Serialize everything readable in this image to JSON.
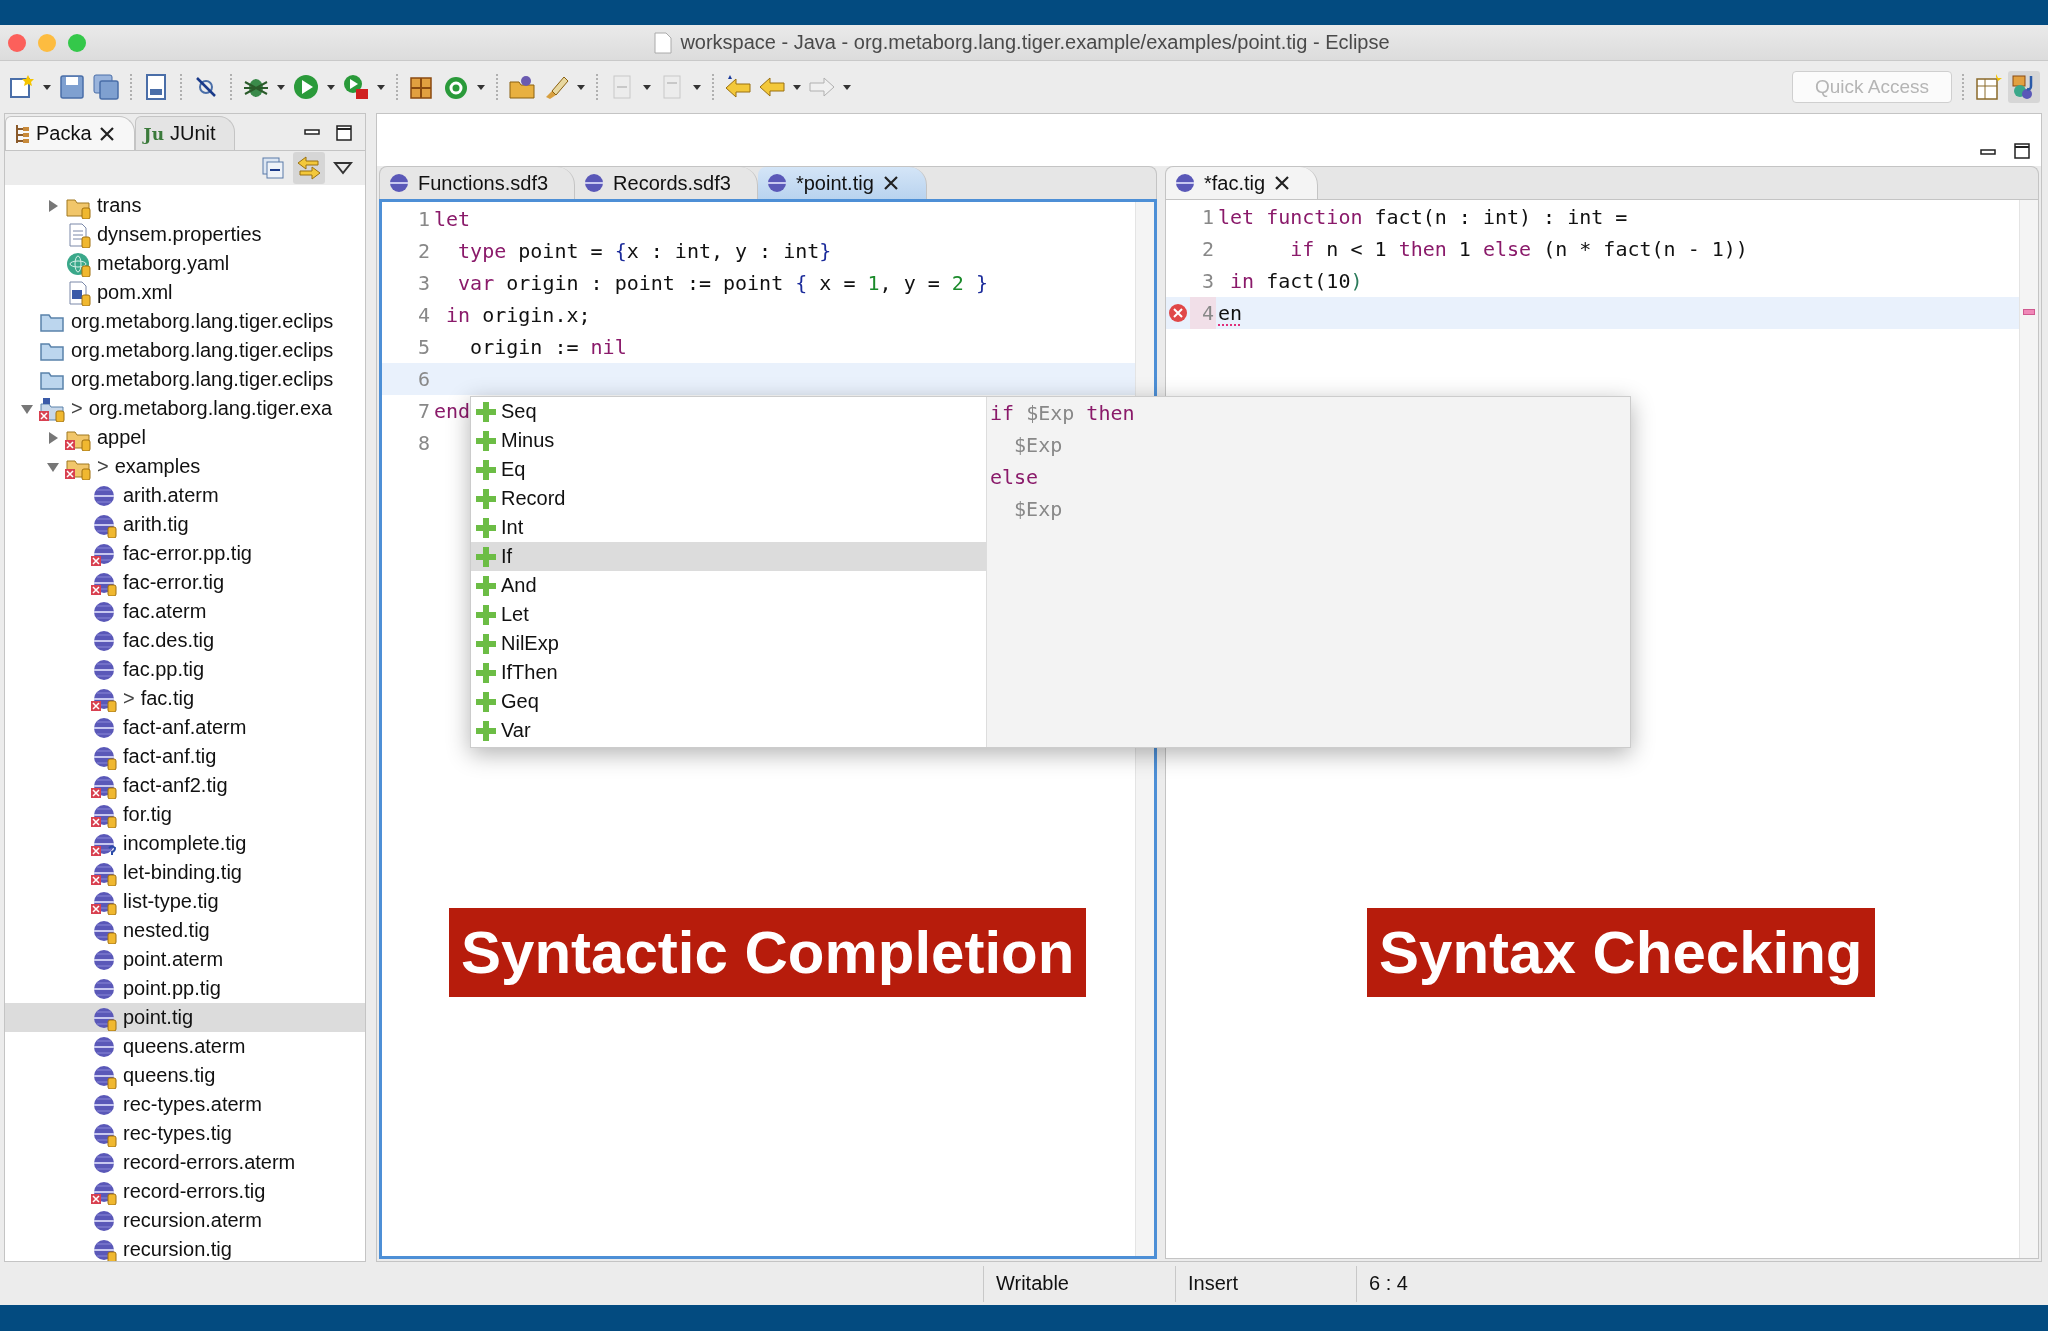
{
  "window": {
    "title": "workspace - Java - org.metaborg.lang.tiger.example/examples/point.tig - Eclipse"
  },
  "toolbar": {
    "quick_access": {
      "placeholder": "Quick Access"
    }
  },
  "left_panel": {
    "tabs": [
      {
        "label": "Packa",
        "selected": true,
        "closable": true,
        "kind": "package"
      },
      {
        "label": "JUnit",
        "selected": false,
        "closable": false,
        "kind": "junit",
        "icon_text": "Ju"
      }
    ],
    "tree": {
      "scrolled_children": [
        {
          "label": "trans",
          "kind": "package-folder",
          "expanded": false,
          "error": false,
          "locked": true,
          "unversioned": false,
          "selected": false
        },
        {
          "label": "dynsem.properties",
          "kind": "properties",
          "error": false,
          "locked": true,
          "unversioned": false,
          "selected": false
        },
        {
          "label": "metaborg.yaml",
          "kind": "yaml",
          "error": false,
          "locked": true,
          "unversioned": false,
          "selected": false
        },
        {
          "label": "pom.xml",
          "kind": "pom",
          "error": false,
          "locked": true,
          "unversioned": false,
          "selected": false
        }
      ],
      "items": [
        {
          "label": "org.metaborg.lang.tiger.eclips",
          "kind": "project",
          "error": false,
          "locked": false,
          "unversioned": false,
          "selected": false
        },
        {
          "label": "org.metaborg.lang.tiger.eclips",
          "kind": "project",
          "error": false,
          "locked": false,
          "unversioned": false,
          "selected": false
        },
        {
          "label": "org.metaborg.lang.tiger.eclips",
          "kind": "project",
          "error": false,
          "locked": false,
          "unversioned": false,
          "selected": false
        },
        {
          "label": "org.metaborg.lang.tiger.exa",
          "kind": "maven-project",
          "marker": ">",
          "expanded": true,
          "error": true,
          "locked": true,
          "unversioned": false,
          "selected": false,
          "children": [
            {
              "label": "appel",
              "kind": "source-folder",
              "expanded": false,
              "error": true,
              "locked": true,
              "unversioned": false,
              "selected": false
            },
            {
              "label": "examples",
              "kind": "source-folder",
              "marker": ">",
              "expanded": true,
              "error": true,
              "locked": true,
              "unversioned": false,
              "selected": false,
              "children": [
                {
                  "label": "arith.aterm",
                  "kind": "term",
                  "error": false,
                  "locked": false,
                  "unversioned": false,
                  "selected": false
                },
                {
                  "label": "arith.tig",
                  "kind": "term",
                  "error": false,
                  "locked": true,
                  "unversioned": false,
                  "selected": false
                },
                {
                  "label": "fac-error.pp.tig",
                  "kind": "term",
                  "error": true,
                  "locked": false,
                  "unversioned": false,
                  "selected": false
                },
                {
                  "label": "fac-error.tig",
                  "kind": "term",
                  "error": true,
                  "locked": true,
                  "unversioned": false,
                  "selected": false
                },
                {
                  "label": "fac.aterm",
                  "kind": "term",
                  "error": false,
                  "locked": false,
                  "unversioned": false,
                  "selected": false
                },
                {
                  "label": "fac.des.tig",
                  "kind": "term",
                  "error": false,
                  "locked": false,
                  "unversioned": false,
                  "selected": false
                },
                {
                  "label": "fac.pp.tig",
                  "kind": "term",
                  "error": false,
                  "locked": false,
                  "unversioned": false,
                  "selected": false
                },
                {
                  "label": "fac.tig",
                  "kind": "term",
                  "marker": ">",
                  "error": true,
                  "locked": true,
                  "unversioned": false,
                  "selected": false
                },
                {
                  "label": "fact-anf.aterm",
                  "kind": "term",
                  "error": false,
                  "locked": false,
                  "unversioned": false,
                  "selected": false
                },
                {
                  "label": "fact-anf.tig",
                  "kind": "term",
                  "error": false,
                  "locked": true,
                  "unversioned": false,
                  "selected": false
                },
                {
                  "label": "fact-anf2.tig",
                  "kind": "term",
                  "error": true,
                  "locked": true,
                  "unversioned": false,
                  "selected": false
                },
                {
                  "label": "for.tig",
                  "kind": "term",
                  "error": true,
                  "locked": true,
                  "unversioned": false,
                  "selected": false
                },
                {
                  "label": "incomplete.tig",
                  "kind": "term",
                  "error": true,
                  "locked": false,
                  "unversioned": true,
                  "selected": false
                },
                {
                  "label": "let-binding.tig",
                  "kind": "term",
                  "error": true,
                  "locked": true,
                  "unversioned": false,
                  "selected": false
                },
                {
                  "label": "list-type.tig",
                  "kind": "term",
                  "error": true,
                  "locked": true,
                  "unversioned": false,
                  "selected": false
                },
                {
                  "label": "nested.tig",
                  "kind": "term",
                  "error": false,
                  "locked": true,
                  "unversioned": false,
                  "selected": false
                },
                {
                  "label": "point.aterm",
                  "kind": "term",
                  "error": false,
                  "locked": false,
                  "unversioned": false,
                  "selected": false
                },
                {
                  "label": "point.pp.tig",
                  "kind": "term",
                  "error": false,
                  "locked": false,
                  "unversioned": false,
                  "selected": false
                },
                {
                  "label": "point.tig",
                  "kind": "term",
                  "error": false,
                  "locked": true,
                  "unversioned": false,
                  "selected": true
                },
                {
                  "label": "queens.aterm",
                  "kind": "term",
                  "error": false,
                  "locked": false,
                  "unversioned": false,
                  "selected": false
                },
                {
                  "label": "queens.tig",
                  "kind": "term",
                  "error": false,
                  "locked": true,
                  "unversioned": false,
                  "selected": false
                },
                {
                  "label": "rec-types.aterm",
                  "kind": "term",
                  "error": false,
                  "locked": false,
                  "unversioned": false,
                  "selected": false
                },
                {
                  "label": "rec-types.tig",
                  "kind": "term",
                  "error": false,
                  "locked": true,
                  "unversioned": false,
                  "selected": false
                },
                {
                  "label": "record-errors.aterm",
                  "kind": "term",
                  "error": false,
                  "locked": false,
                  "unversioned": false,
                  "selected": false
                },
                {
                  "label": "record-errors.tig",
                  "kind": "term",
                  "error": true,
                  "locked": true,
                  "unversioned": false,
                  "selected": false
                },
                {
                  "label": "recursion.aterm",
                  "kind": "term",
                  "error": false,
                  "locked": false,
                  "unversioned": false,
                  "selected": false
                },
                {
                  "label": "recursion.tig",
                  "kind": "term",
                  "error": false,
                  "locked": true,
                  "unversioned": false,
                  "selected": false
                }
              ]
            }
          ]
        }
      ]
    }
  },
  "editors": [
    {
      "active": true,
      "tabs": [
        {
          "label": "Functions.sdf3",
          "selected": false,
          "closable": false
        },
        {
          "label": "Records.sdf3",
          "selected": false,
          "closable": false
        },
        {
          "label": "*point.tig",
          "selected": true,
          "closable": true
        }
      ],
      "lines": [
        {
          "number": "1",
          "current": false,
          "error": false,
          "tokens": [
            {
              "kind": "kw",
              "text": "let"
            }
          ]
        },
        {
          "number": "2",
          "current": false,
          "error": false,
          "tokens": [
            {
              "kind": "kw",
              "text": "  type"
            },
            {
              "kind": "plain",
              "text": " point = "
            },
            {
              "kind": "brace",
              "text": "{"
            },
            {
              "kind": "plain",
              "text": "x : int, y : int"
            },
            {
              "kind": "brace",
              "text": "}"
            }
          ]
        },
        {
          "number": "3",
          "current": false,
          "error": false,
          "tokens": [
            {
              "kind": "kw",
              "text": "  var"
            },
            {
              "kind": "plain",
              "text": " origin : point := point "
            },
            {
              "kind": "brace",
              "text": "{"
            },
            {
              "kind": "plain",
              "text": " x = "
            },
            {
              "kind": "num",
              "text": "1"
            },
            {
              "kind": "plain",
              "text": ", y = "
            },
            {
              "kind": "num",
              "text": "2"
            },
            {
              "kind": "brace",
              "text": " }"
            }
          ]
        },
        {
          "number": "4",
          "current": false,
          "error": false,
          "tokens": [
            {
              "kind": "kw",
              "text": " in"
            },
            {
              "kind": "plain",
              "text": " origin.x;"
            }
          ]
        },
        {
          "number": "5",
          "current": false,
          "error": false,
          "tokens": [
            {
              "kind": "plain",
              "text": "   origin := "
            },
            {
              "kind": "kw",
              "text": "nil"
            }
          ]
        },
        {
          "number": "6",
          "current": true,
          "error": false
        },
        {
          "number": "7",
          "current": false,
          "error": false,
          "tokens": [
            {
              "kind": "kw",
              "text": "end"
            }
          ]
        },
        {
          "number": "8",
          "current": false,
          "error": false
        }
      ],
      "overlay_label": "Syntactic Completion"
    },
    {
      "active": false,
      "tabs": [
        {
          "label": "*fac.tig",
          "selected": true,
          "closable": true
        }
      ],
      "lines": [
        {
          "number": "1",
          "current": false,
          "error": false,
          "tokens": [
            {
              "kind": "kw",
              "text": "let"
            },
            {
              "kind": "kw",
              "text": " function"
            },
            {
              "kind": "plain",
              "text": " fact(n : int) : int ="
            }
          ]
        },
        {
          "number": "2",
          "current": false,
          "error": false,
          "tokens": [
            {
              "kind": "kw",
              "text": "      if"
            },
            {
              "kind": "plain",
              "text": " n < 1 "
            },
            {
              "kind": "kw",
              "text": "then"
            },
            {
              "kind": "plain",
              "text": " 1 "
            },
            {
              "kind": "kw",
              "text": "else"
            },
            {
              "kind": "plain",
              "text": " (n * fact(n - 1))"
            }
          ]
        },
        {
          "number": "3",
          "current": false,
          "error": false,
          "tokens": [
            {
              "kind": "kw",
              "text": " in"
            },
            {
              "kind": "plain",
              "text": " fact(10"
            },
            {
              "kind": "match",
              "text": ")"
            }
          ]
        },
        {
          "number": "4",
          "current": true,
          "error": true,
          "tokens": [
            {
              "kind": "error",
              "text": "en"
            }
          ]
        }
      ],
      "overlay_label": "Syntax Checking"
    }
  ],
  "completion": {
    "items": [
      {
        "label": "Seq",
        "selected": false
      },
      {
        "label": "Minus",
        "selected": false
      },
      {
        "label": "Eq",
        "selected": false
      },
      {
        "label": "Record",
        "selected": false
      },
      {
        "label": "Int",
        "selected": false
      },
      {
        "label": "If",
        "selected": true
      },
      {
        "label": "And",
        "selected": false
      },
      {
        "label": "Let",
        "selected": false
      },
      {
        "label": "NilExp",
        "selected": false
      },
      {
        "label": "IfThen",
        "selected": false
      },
      {
        "label": "Geq",
        "selected": false
      },
      {
        "label": "Var",
        "selected": false
      }
    ],
    "preview": [
      [
        {
          "kind": "kw",
          "text": "if"
        },
        {
          "kind": "placeholder",
          "text": " $Exp "
        },
        {
          "kind": "kw",
          "text": "then"
        }
      ],
      [
        {
          "kind": "placeholder",
          "text": "  $Exp"
        }
      ],
      [
        {
          "kind": "kw",
          "text": "else"
        }
      ],
      [
        {
          "kind": "placeholder",
          "text": "  $Exp"
        }
      ]
    ]
  },
  "status_bar": [
    {
      "text": "Writable"
    },
    {
      "text": "Insert"
    },
    {
      "text": "6 : 4"
    }
  ]
}
